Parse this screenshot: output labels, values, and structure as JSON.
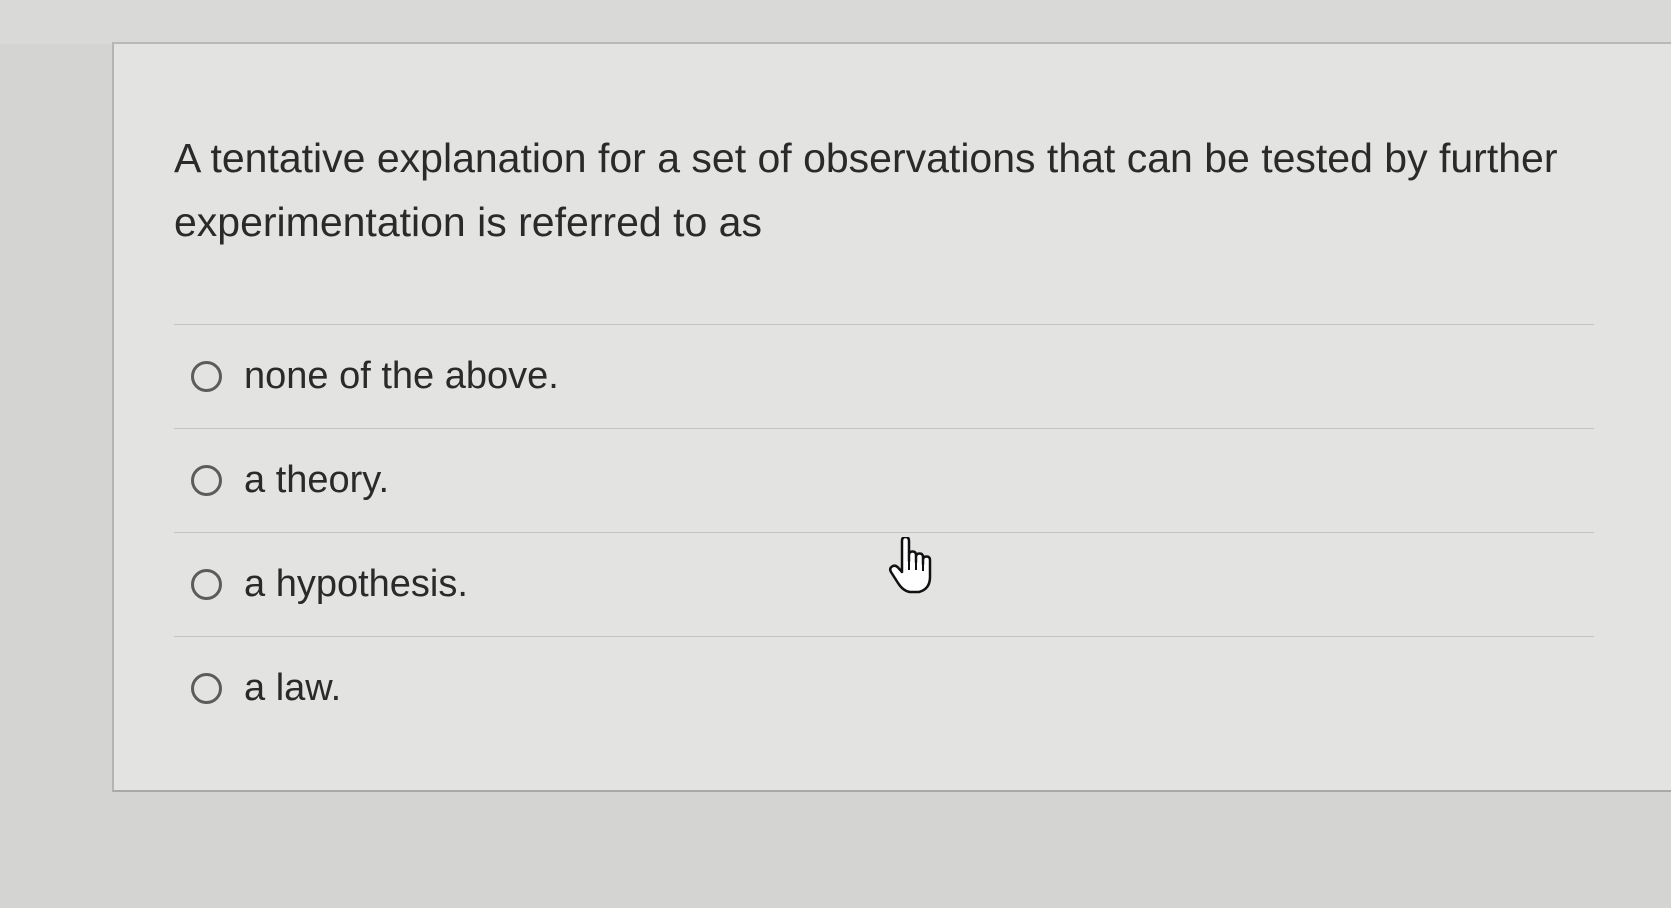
{
  "question": {
    "text": "A tentative explanation for a set of observations that can be tested by further experimentation is referred to as"
  },
  "answers": [
    {
      "label": "none of the above.",
      "selected": false
    },
    {
      "label": "a theory.",
      "selected": false
    },
    {
      "label": "a hypothesis.",
      "selected": false
    },
    {
      "label": "a law.",
      "selected": false
    }
  ],
  "cursor": {
    "icon": "hand-pointer-icon"
  }
}
